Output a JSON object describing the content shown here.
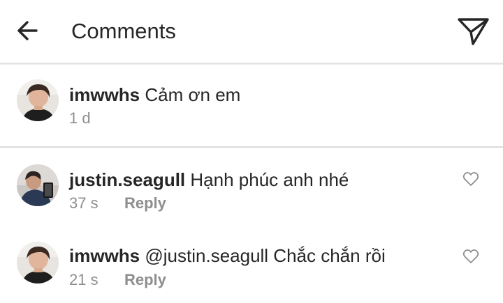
{
  "header": {
    "title": "Comments",
    "back_icon": "arrow-left-icon",
    "send_icon": "paper-plane-icon"
  },
  "caption": {
    "username": "imwwhs",
    "text": "Cảm ơn em",
    "time": "1 d"
  },
  "comments": [
    {
      "username": "justin.seagull",
      "text": "Hạnh phúc anh nhé",
      "time": "37 s",
      "reply_label": "Reply",
      "like_icon": "heart-outline-icon"
    },
    {
      "username": "imwwhs",
      "text": "@justin.seagull Chắc chắn rồi",
      "time": "21 s",
      "reply_label": "Reply",
      "like_icon": "heart-outline-icon"
    }
  ],
  "colors": {
    "text_primary": "#262626",
    "text_secondary": "#8e8e8e",
    "divider": "#dbdbdb"
  }
}
